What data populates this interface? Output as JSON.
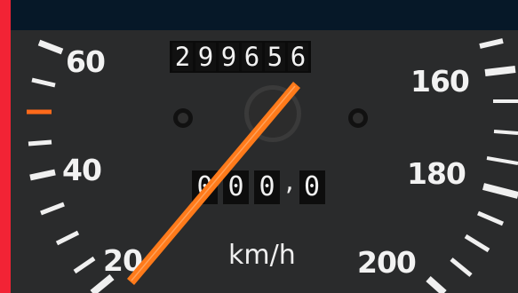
{
  "speedometer": {
    "odometer_digits": [
      "2",
      "9",
      "9",
      "6",
      "5",
      "6"
    ],
    "trip_digits": [
      "0",
      "0",
      "0"
    ],
    "trip_decimal": "0",
    "trip_separator": ",",
    "unit": "km/h",
    "speed_labels": {
      "s20": "20",
      "s40": "40",
      "s60": "60",
      "s160": "160",
      "s180": "180",
      "s200": "200"
    },
    "current_speed_kmh": 0,
    "colors": {
      "dial_face": "#2a2b2c",
      "needle": "#ff7a1a",
      "marking": "#f2f2f2",
      "accent_tick": "#ff6a1a",
      "top_bar": "#061828",
      "left_strip": "#f22335"
    }
  }
}
